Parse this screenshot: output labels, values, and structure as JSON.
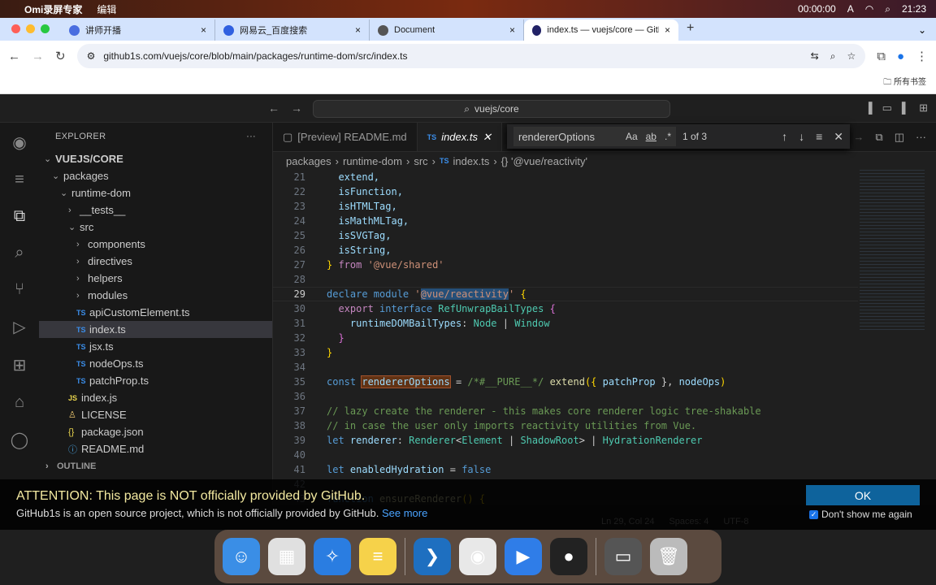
{
  "menubar": {
    "app": "Omi录屏专家",
    "menu": "编辑",
    "timer": "00:00:00",
    "input": "A",
    "clock": "21:23"
  },
  "browser": {
    "tabs": [
      {
        "label": "讲师开播",
        "fav": "#4a6ee0"
      },
      {
        "label": "网易云_百度搜索",
        "fav": "#3060e0"
      },
      {
        "label": "Document",
        "fav": "#555"
      },
      {
        "label": "index.ts — vuejs/core — GitHub",
        "fav": "#222266",
        "active": true
      }
    ],
    "url": "github1s.com/vuejs/core/blob/main/packages/runtime-dom/src/index.ts",
    "bookmarks_label": "所有书签"
  },
  "vscode": {
    "command_center": "vuejs/core",
    "explorer_title": "EXPLORER",
    "tree": [
      {
        "label": "VUEJS/CORE",
        "indent": 0,
        "chev": "⌄",
        "bold": true
      },
      {
        "label": "packages",
        "indent": 1,
        "chev": "⌄"
      },
      {
        "label": "runtime-dom",
        "indent": 2,
        "chev": "⌄"
      },
      {
        "label": "__tests__",
        "indent": 3,
        "chev": "›"
      },
      {
        "label": "src",
        "indent": 3,
        "chev": "⌄"
      },
      {
        "label": "components",
        "indent": 4,
        "chev": "›"
      },
      {
        "label": "directives",
        "indent": 4,
        "chev": "›"
      },
      {
        "label": "helpers",
        "indent": 4,
        "chev": "›"
      },
      {
        "label": "modules",
        "indent": 4,
        "chev": "›"
      },
      {
        "label": "apiCustomElement.ts",
        "indent": 4,
        "icon": "TS"
      },
      {
        "label": "index.ts",
        "indent": 4,
        "icon": "TS",
        "selected": true
      },
      {
        "label": "jsx.ts",
        "indent": 4,
        "icon": "TS"
      },
      {
        "label": "nodeOps.ts",
        "indent": 4,
        "icon": "TS"
      },
      {
        "label": "patchProp.ts",
        "indent": 4,
        "icon": "TS"
      },
      {
        "label": "index.js",
        "indent": 3,
        "icon": "JS"
      },
      {
        "label": "LICENSE",
        "indent": 3,
        "icon": "LIC"
      },
      {
        "label": "package.json",
        "indent": 3,
        "icon": "{}"
      },
      {
        "label": "README.md",
        "indent": 3,
        "icon": "MD"
      }
    ],
    "outline_label": "OUTLINE",
    "editor_tabs": [
      {
        "label": "[Preview] README.md",
        "icon": ""
      },
      {
        "label": "index.ts",
        "icon": "TS",
        "active": true
      }
    ],
    "breadcrumbs": [
      "packages",
      "runtime-dom",
      "src",
      "index.ts",
      "{} '@vue/reactivity'"
    ],
    "find": {
      "value": "rendererOptions",
      "case": "Aa",
      "word": "ab",
      "regex": ".*",
      "count": "1 of 3"
    },
    "current_line": 29,
    "code": [
      {
        "n": 21,
        "t": [
          [
            "  extend,",
            "id"
          ]
        ]
      },
      {
        "n": 22,
        "t": [
          [
            "  isFunction,",
            "id"
          ]
        ]
      },
      {
        "n": 23,
        "t": [
          [
            "  isHTMLTag,",
            "id"
          ]
        ]
      },
      {
        "n": 24,
        "t": [
          [
            "  isMathMLTag,",
            "id"
          ]
        ]
      },
      {
        "n": 25,
        "t": [
          [
            "  isSVGTag,",
            "id"
          ]
        ]
      },
      {
        "n": 26,
        "t": [
          [
            "  isString,",
            "id"
          ]
        ]
      },
      {
        "n": 27,
        "t": [
          [
            "}",
            "br"
          ],
          [
            " from ",
            "kw"
          ],
          [
            "'@vue/shared'",
            "str"
          ]
        ]
      },
      {
        "n": 28,
        "t": []
      },
      {
        "n": 29,
        "t": [
          [
            "declare module ",
            "dec"
          ],
          [
            "'",
            "str"
          ],
          [
            "@vue/reactivity",
            "sel"
          ],
          [
            "'",
            "str"
          ],
          [
            " {",
            "br"
          ]
        ]
      },
      {
        "n": 30,
        "t": [
          [
            "  export ",
            "kw"
          ],
          [
            "interface ",
            "dec"
          ],
          [
            "RefUnwrapBailTypes ",
            "ty"
          ],
          [
            "{",
            "br2"
          ]
        ]
      },
      {
        "n": 31,
        "t": [
          [
            "    runtimeDOMBailTypes",
            "id"
          ],
          [
            ": ",
            "p"
          ],
          [
            "Node",
            "ty"
          ],
          [
            " | ",
            "p"
          ],
          [
            "Window",
            "ty"
          ]
        ]
      },
      {
        "n": 32,
        "t": [
          [
            "  }",
            "br2"
          ]
        ]
      },
      {
        "n": 33,
        "t": [
          [
            "}",
            "br"
          ]
        ]
      },
      {
        "n": 34,
        "t": []
      },
      {
        "n": 35,
        "t": [
          [
            "const ",
            "dec"
          ],
          [
            "rendererOptions",
            "hl"
          ],
          [
            " = ",
            "p"
          ],
          [
            "/*#__PURE__*/ ",
            "cm"
          ],
          [
            "extend",
            "fn"
          ],
          [
            "({ ",
            "br"
          ],
          [
            "patchProp",
            "id"
          ],
          [
            " }, ",
            "p"
          ],
          [
            "nodeOps",
            "id"
          ],
          [
            ")",
            "br"
          ]
        ]
      },
      {
        "n": 36,
        "t": []
      },
      {
        "n": 37,
        "t": [
          [
            "// lazy create the renderer - this makes core renderer logic tree-shakable",
            "cm"
          ]
        ]
      },
      {
        "n": 38,
        "t": [
          [
            "// in case the user only imports reactivity utilities from Vue.",
            "cm"
          ]
        ]
      },
      {
        "n": 39,
        "t": [
          [
            "let ",
            "dec"
          ],
          [
            "renderer",
            "id"
          ],
          [
            ": ",
            "p"
          ],
          [
            "Renderer",
            "ty"
          ],
          [
            "<",
            "p"
          ],
          [
            "Element",
            "ty"
          ],
          [
            " | ",
            "p"
          ],
          [
            "ShadowRoot",
            "ty"
          ],
          [
            "> | ",
            "p"
          ],
          [
            "HydrationRenderer",
            "ty"
          ]
        ]
      },
      {
        "n": 40,
        "t": []
      },
      {
        "n": 41,
        "t": [
          [
            "let ",
            "dec"
          ],
          [
            "enabledHydration",
            "id"
          ],
          [
            " = ",
            "p"
          ],
          [
            "false",
            "dec"
          ]
        ]
      },
      {
        "n": 42,
        "t": []
      },
      {
        "n": 43,
        "t": [
          [
            "function ",
            "dec"
          ],
          [
            "ensureRenderer",
            "fn"
          ],
          [
            "() {",
            "br"
          ]
        ]
      }
    ],
    "status": [
      "Ln 29, Col 24",
      "Spaces: 4",
      "UTF-8"
    ]
  },
  "banner": {
    "title": "ATTENTION: This page is NOT officially provided by GitHub.",
    "text": "GitHub1s is an open source project, which is not officially provided by GitHub.",
    "link": "See more",
    "ok": "OK",
    "checkbox": "Don't show me again",
    "checked": true
  },
  "dock": [
    {
      "name": "finder",
      "color": "#3a8ee6",
      "g": "☺"
    },
    {
      "name": "launchpad",
      "color": "#e0e0e0",
      "g": "▦"
    },
    {
      "name": "safari",
      "color": "#2a7de1",
      "g": "✧"
    },
    {
      "name": "notes",
      "color": "#f6d24a",
      "g": "≡"
    },
    {
      "name": "vscode",
      "color": "#1e6fc0",
      "g": "❯"
    },
    {
      "name": "chrome",
      "color": "#e8e8e8",
      "g": "◉"
    },
    {
      "name": "live",
      "color": "#2f7de8",
      "g": "▶"
    },
    {
      "name": "recorder",
      "color": "#222",
      "g": "●"
    },
    {
      "name": "screens",
      "color": "#555",
      "g": "▭"
    },
    {
      "name": "trash",
      "color": "#bbb",
      "g": "🗑"
    }
  ]
}
